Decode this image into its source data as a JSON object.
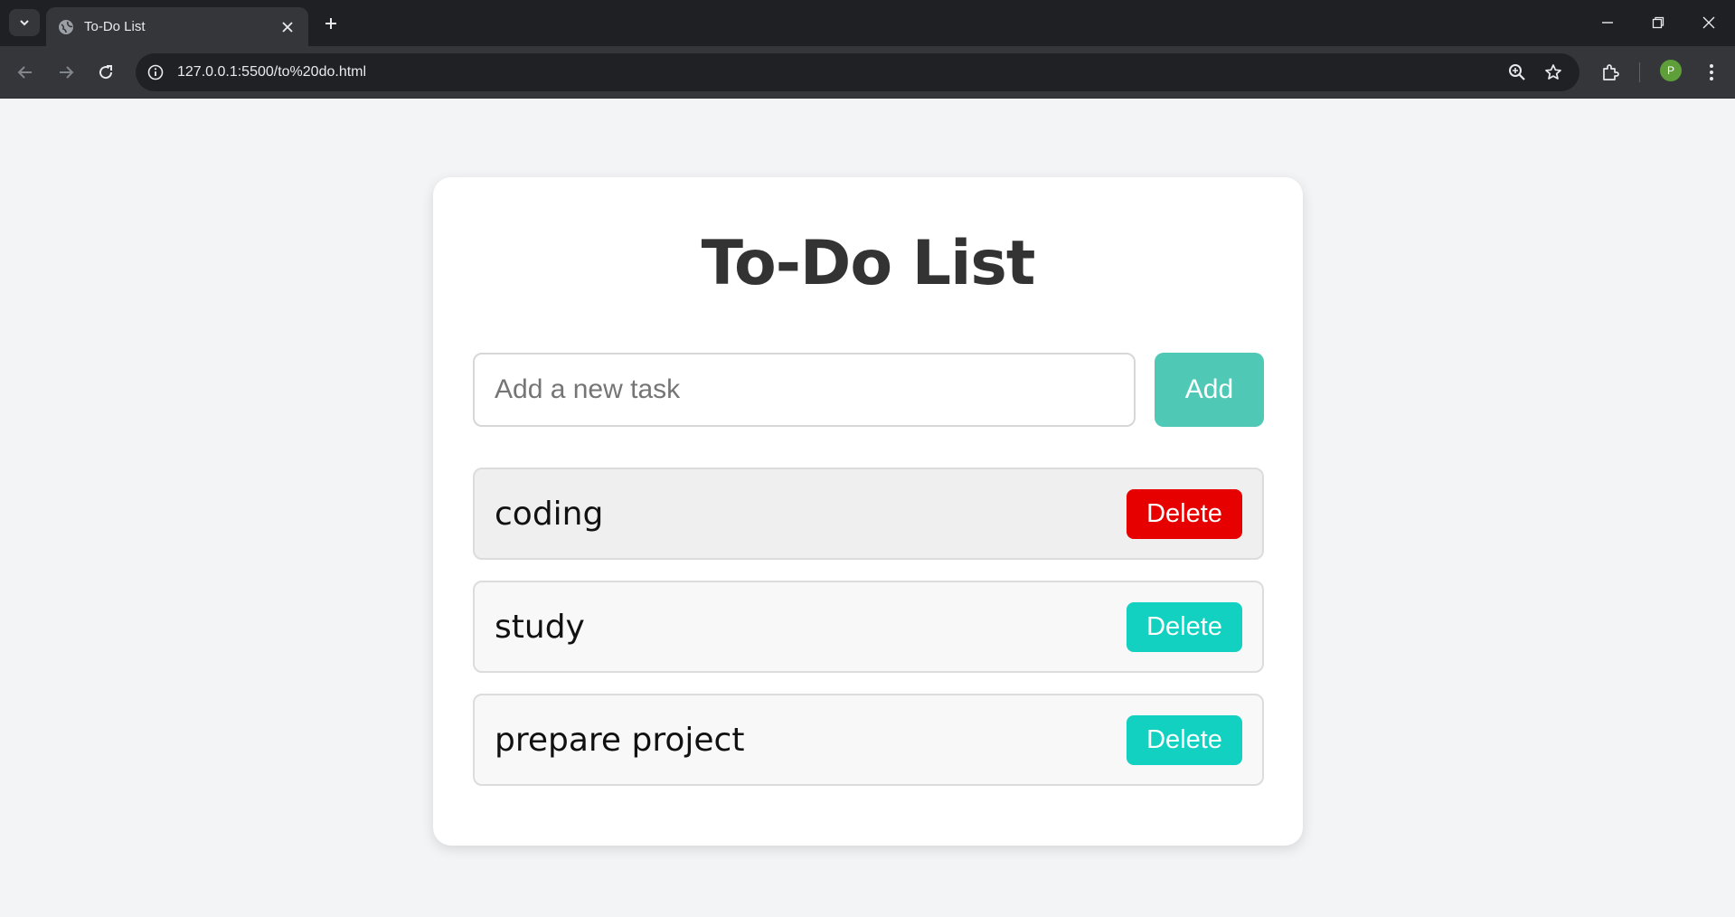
{
  "browser": {
    "tab_title": "To-Do List",
    "url": "127.0.0.1:5500/to%20do.html",
    "profile_initial": "P"
  },
  "colors": {
    "accent": "#4fc9b6",
    "delete": "#13d1c1",
    "delete_hover": "#e60000",
    "title": "#333333"
  },
  "app": {
    "title": "To-Do List",
    "input_placeholder": "Add a new task",
    "input_value": "",
    "add_label": "Add",
    "tasks": [
      {
        "text": "coding",
        "delete_label": "Delete",
        "state": "hover"
      },
      {
        "text": "study",
        "delete_label": "Delete",
        "state": "normal"
      },
      {
        "text": "prepare project",
        "delete_label": "Delete",
        "state": "normal"
      }
    ]
  }
}
